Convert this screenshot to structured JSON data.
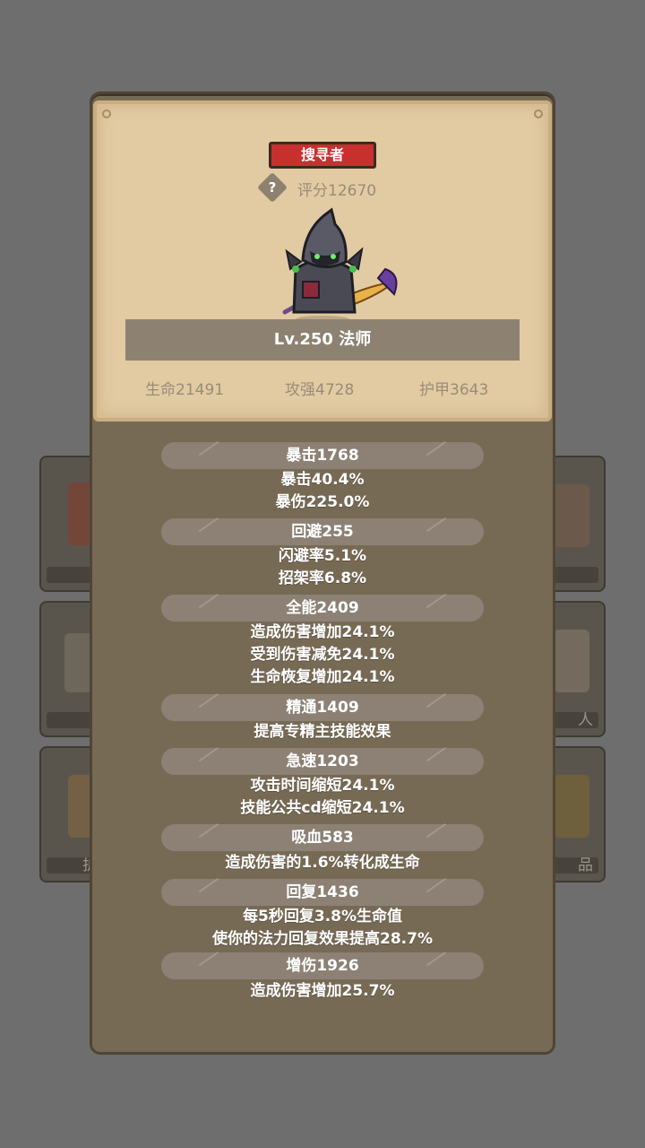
{
  "badge": "搜寻者",
  "help_symbol": "?",
  "score": "评分12670",
  "name_bar": "Lv.250 法师",
  "stats": {
    "hp": "生命21491",
    "atk": "攻强4728",
    "armor": "护甲3643"
  },
  "background_cards": {
    "left_labels": [
      "",
      "",
      "护"
    ],
    "right_labels": [
      "",
      "人",
      "品"
    ]
  },
  "attributes": [
    {
      "header": "暴击1768",
      "lines": [
        "暴击40.4%",
        "暴伤225.0%"
      ]
    },
    {
      "header": "回避255",
      "lines": [
        "闪避率5.1%",
        "招架率6.8%"
      ]
    },
    {
      "header": "全能2409",
      "lines": [
        "造成伤害增加24.1%",
        "受到伤害减免24.1%",
        "生命恢复增加24.1%"
      ]
    },
    {
      "header": "精通1409",
      "lines": [
        "提高专精主技能效果"
      ]
    },
    {
      "header": "急速1203",
      "lines": [
        "攻击时间缩短24.1%",
        "技能公共cd缩短24.1%"
      ]
    },
    {
      "header": "吸血583",
      "lines": [
        "造成伤害的1.6%转化成生命"
      ]
    },
    {
      "header": "回复1436",
      "lines": [
        "每5秒回复3.8%生命值",
        "使你的法力回复效果提高28.7%"
      ]
    },
    {
      "header": "增伤1926",
      "lines": [
        "造成伤害增加25.7%"
      ]
    }
  ]
}
